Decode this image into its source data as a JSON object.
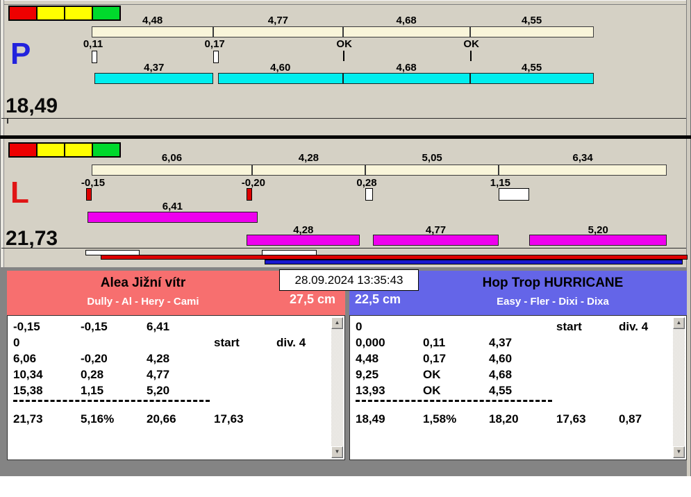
{
  "colors": {
    "lane_p": "#2222dd",
    "lane_l": "#e01515",
    "split_bar": "#f9f5da",
    "dog_bar_p": "#00eeee",
    "dog_bar_l": "#ee00ee",
    "marker_negative": "#dd0000",
    "marker_positive": "#ffffff",
    "team_left_bg": "#f76f6f",
    "team_right_bg": "#6465e8",
    "timeline_red": "#dd0000",
    "timeline_blue": "#1818cf",
    "lights": [
      "#ee0000",
      "#ffff00",
      "#ffff00",
      "#00d92c"
    ]
  },
  "clock": "28.09.2024 13:35:43",
  "icons": {
    "scroll_up": "▲",
    "scroll_down": "▼"
  },
  "lane_p": {
    "label": "P",
    "total": "18,49",
    "splits": [
      {
        "label": "4,48",
        "value": 4.48
      },
      {
        "label": "4,77",
        "value": 4.77
      },
      {
        "label": "4,68",
        "value": 4.68
      },
      {
        "label": "4,55",
        "value": 4.55
      }
    ],
    "starts": [
      {
        "label": "0,11",
        "value": 0.11
      },
      {
        "label": "0,17",
        "value": 0.17
      },
      {
        "label": "OK"
      },
      {
        "label": "OK"
      }
    ],
    "runs": [
      {
        "label": "4,37",
        "value": 4.37
      },
      {
        "label": "4,60",
        "value": 4.6
      },
      {
        "label": "4,68",
        "value": 4.68
      },
      {
        "label": "4,55",
        "value": 4.55
      }
    ]
  },
  "lane_l": {
    "label": "L",
    "total": "21,73",
    "splits": [
      {
        "label": "6,06",
        "value": 6.06
      },
      {
        "label": "4,28",
        "value": 4.28
      },
      {
        "label": "5,05",
        "value": 5.05
      },
      {
        "label": "6,34",
        "value": 6.34
      }
    ],
    "starts": [
      {
        "label": "-0,15",
        "value": -0.15
      },
      {
        "label": "-0,20",
        "value": -0.2
      },
      {
        "label": "0,28",
        "value": 0.28
      },
      {
        "label": "1,15",
        "value": 1.15
      }
    ],
    "runs": [
      {
        "label": "6,41",
        "value": 6.41
      },
      {
        "label": "4,28",
        "value": 4.28
      },
      {
        "label": "4,77",
        "value": 4.77
      },
      {
        "label": "5,20",
        "value": 5.2
      }
    ]
  },
  "team_left": {
    "name": "Alea Jižní vítr",
    "dogs": "Dully - Al - Hery - Cami",
    "jump_height": "27,5 cm",
    "rows": [
      [
        "-0,15",
        "-0,15",
        "6,41",
        "",
        ""
      ],
      [
        "0",
        "",
        "",
        "start",
        "div. 4"
      ],
      [
        "6,06",
        "-0,20",
        "4,28",
        "",
        ""
      ],
      [
        "10,34",
        "0,28",
        "4,77",
        "",
        ""
      ],
      [
        "15,38",
        "1,15",
        "5,20",
        "",
        ""
      ]
    ],
    "summary": [
      "21,73",
      "5,16%",
      "20,66",
      "17,63",
      ""
    ]
  },
  "team_right": {
    "name": "Hop Trop HURRICANE",
    "dogs": "Easy - Fler - Dixi - Dixa",
    "jump_height": "22,5 cm",
    "rows": [
      [
        "0",
        "",
        "",
        "start",
        "div. 4"
      ],
      [
        "0,000",
        "0,11",
        "4,37",
        "",
        ""
      ],
      [
        "4,48",
        "0,17",
        "4,60",
        "",
        ""
      ],
      [
        "9,25",
        "OK",
        "4,68",
        "",
        ""
      ],
      [
        "13,93",
        "OK",
        "4,55",
        "",
        ""
      ]
    ],
    "summary": [
      "18,49",
      "1,58%",
      "18,20",
      "17,63",
      "0,87"
    ]
  }
}
